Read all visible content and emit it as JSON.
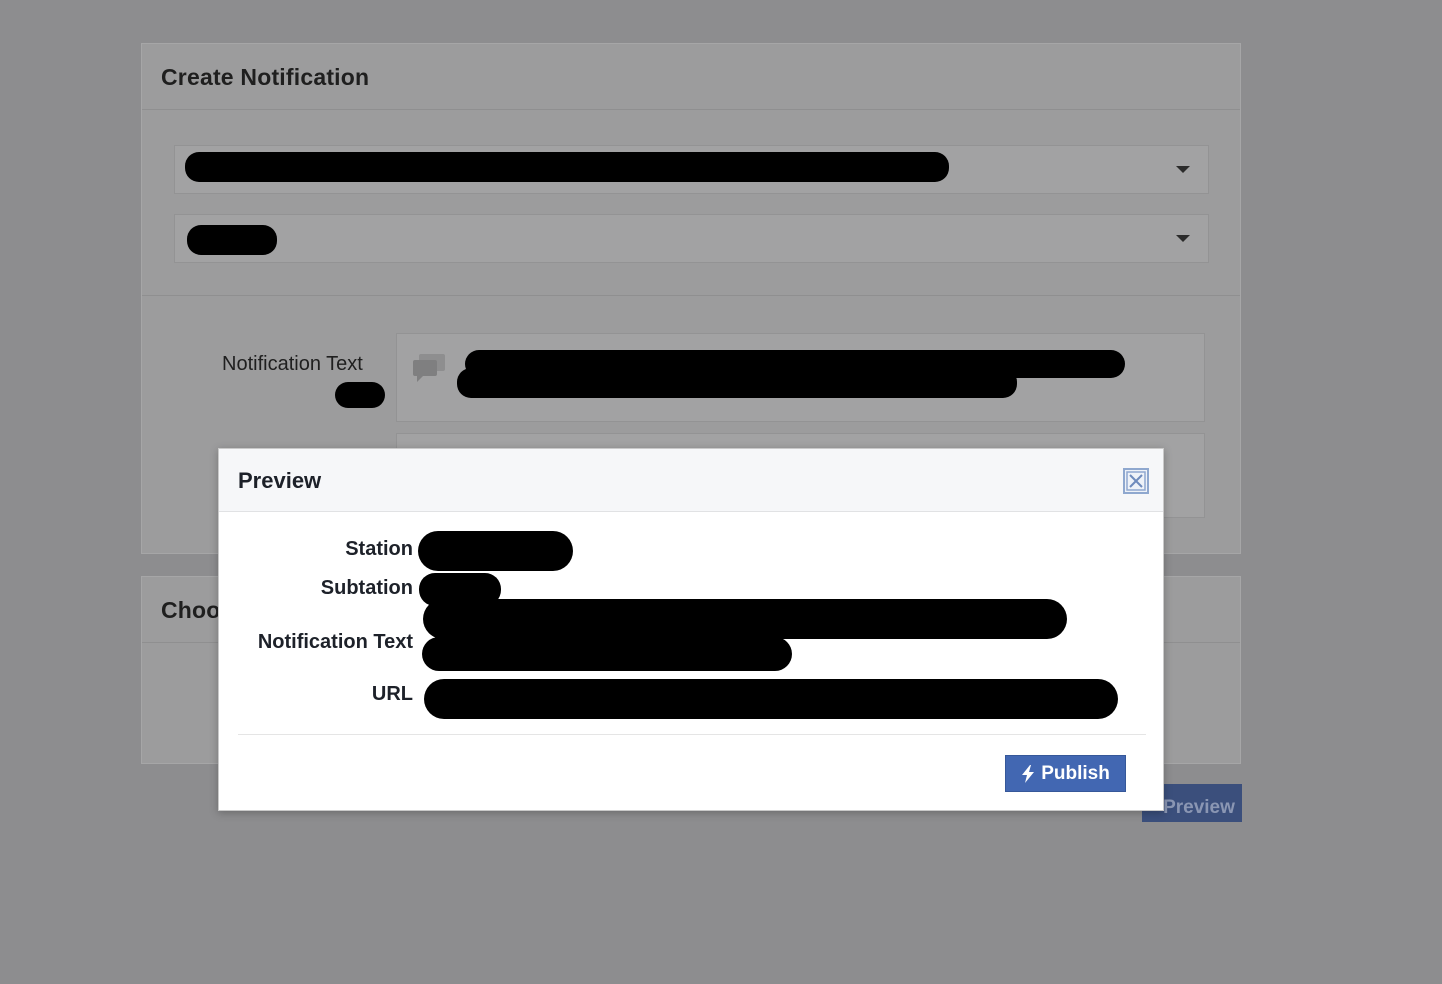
{
  "background": {
    "create_panel": {
      "title": "Create Notification",
      "notification_text_label": "Notification Text"
    },
    "choose_panel": {
      "title": "Choo"
    },
    "preview_button_label": "Preview"
  },
  "modal": {
    "title": "Preview",
    "fields": {
      "station_label": "Station",
      "subtation_label": "Subtation",
      "notification_text_label": "Notification Text",
      "url_label": "URL"
    },
    "publish_label": "Publish"
  },
  "icons": {
    "close": "close-icon",
    "bolt": "bolt-icon",
    "chat": "chat-bubbles-icon",
    "caret": "chevron-down-icon"
  },
  "colors": {
    "accent": "#4267b2",
    "backdrop": "#8d8d8f"
  }
}
